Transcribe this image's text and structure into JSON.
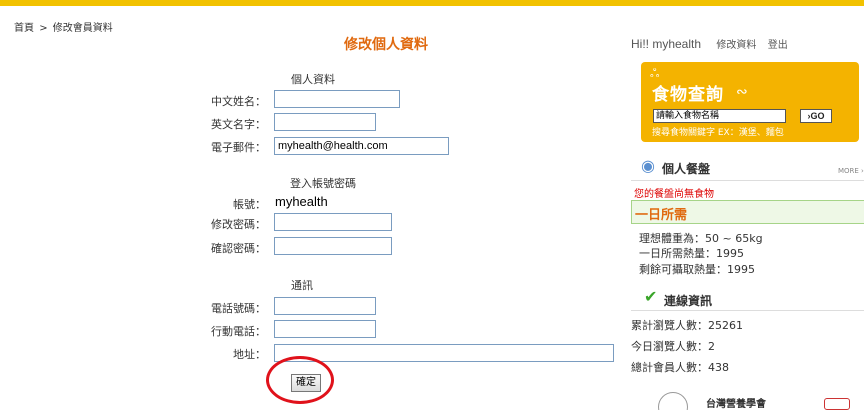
{
  "breadcrumb": {
    "home": "首頁",
    "sep": ">",
    "current": "修改會員資料"
  },
  "page_title": "修改個人資料",
  "personal": {
    "section": "個人資料",
    "chinese_name_label": "中文姓名：",
    "english_name_label": "英文名字：",
    "email_label": "電子郵件：",
    "email_value": "myhealth@health.com"
  },
  "login": {
    "section": "登入帳號密碼",
    "account_label": "帳號：",
    "account_value": "myhealth",
    "change_pw_label": "修改密碼：",
    "confirm_pw_label": "確認密碼："
  },
  "contact": {
    "section": "通訊",
    "phone_label": "電話號碼：",
    "mobile_label": "行動電話：",
    "address_label": "地址："
  },
  "confirm_button": "確定",
  "sidebar": {
    "greeting": "Hi!! myhealth",
    "edit_link": "修改資料",
    "logout_link": "登出",
    "food_search": {
      "title": "食物查詢",
      "input_value": "請輸入食物名稱",
      "go_label": "›GO",
      "hint": "搜尋食物關鍵字 EX：漢堡、麵包"
    },
    "meal": {
      "title": "個人餐盤",
      "more": "MORE ›",
      "empty_notice": "您的餐盤尚無食物"
    },
    "daily": {
      "title": "一日所需",
      "ideal_weight": "理想體重為：50 ~ 65kg",
      "daily_calories": "一日所需熱量：1995",
      "remaining_calories": "剩餘可攝取熱量：1995"
    },
    "online": {
      "title": "連線資訊",
      "total_visitors": "累計瀏覽人數：25261",
      "today_visitors": "今日瀏覽人數：2",
      "total_members": "總計會員人數：438"
    },
    "footer_logo_text": "台灣營養學會"
  },
  "colors": {
    "accent_orange": "#e06a10",
    "banner_yellow": "#f4b300",
    "highlight_red": "#e0121b"
  }
}
